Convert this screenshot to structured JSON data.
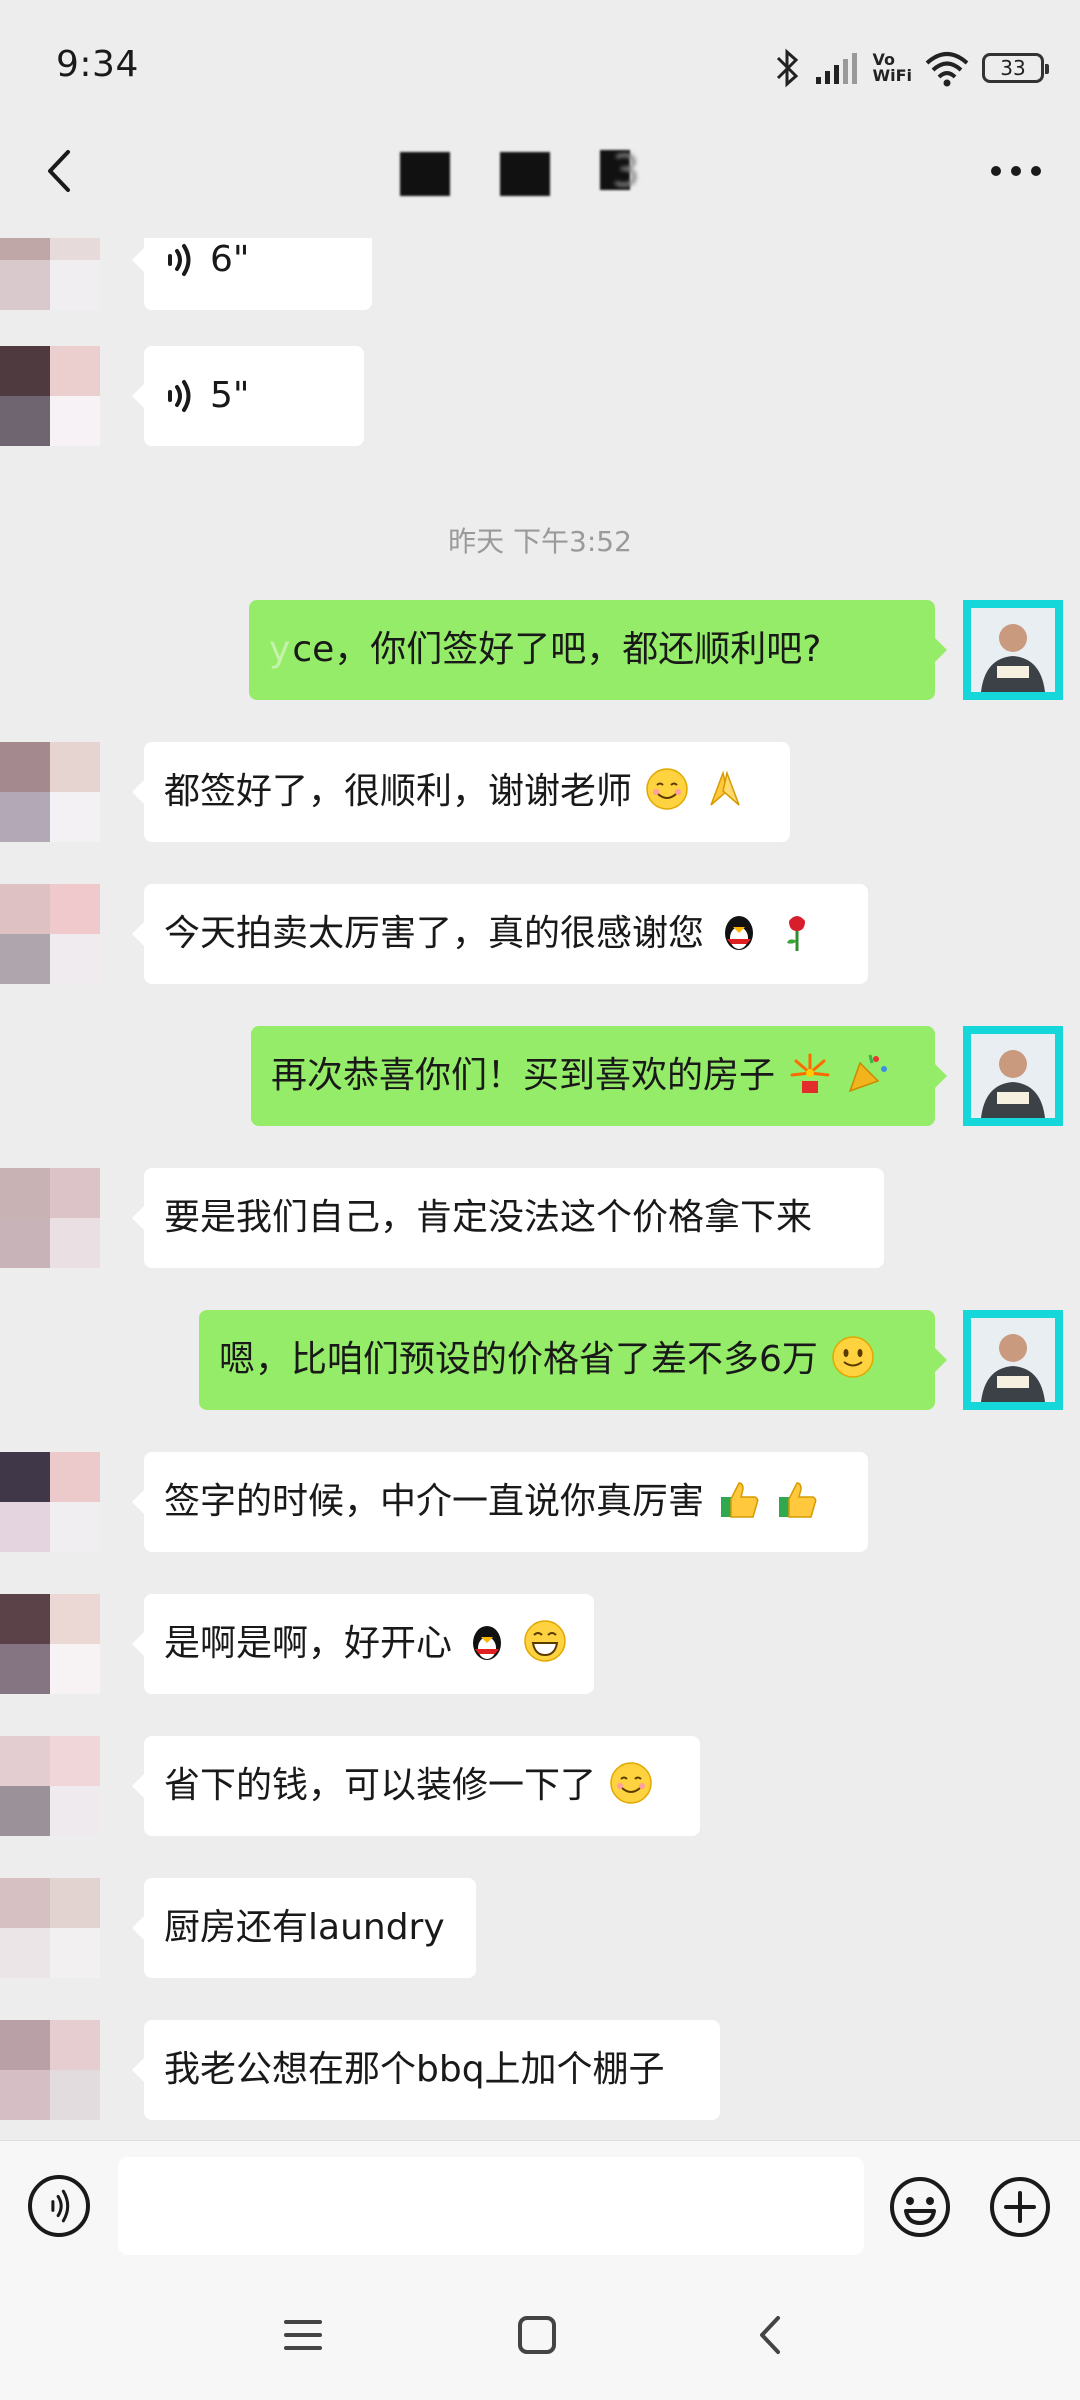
{
  "status": {
    "time": "9:34",
    "volte_line1": "Vo",
    "volte_line2": "WiFi",
    "battery": "33"
  },
  "header": {
    "title_suffix": "3"
  },
  "messages": {
    "voice1_duration": "6\"",
    "voice2_duration": "5\"",
    "timestamp": "昨天 下午3:52",
    "m1": "ce，你们签好了吧，都还顺利吧?",
    "m2": "都签好了，很顺利，谢谢老师",
    "m3": "今天拍卖太厉害了，真的很感谢您",
    "m4": "再次恭喜你们！买到喜欢的房子",
    "m5": "要是我们自己，肯定没法这个价格拿下来",
    "m6": "嗯，比咱们预设的价格省了差不多6万",
    "m7": "签字的时候，中介一直说你真厉害",
    "m8": "是啊是啊，好开心",
    "m9": "省下的钱，可以装修一下了",
    "m10": "厨房还有laundry",
    "m11": "我老公想在那个bbq上加个棚子"
  },
  "input": {
    "placeholder": ""
  },
  "colors": {
    "background": "#EDEDED",
    "outgoing_bubble": "#95EC69",
    "incoming_bubble": "#FFFFFF",
    "self_avatar_bg": "#15D6D8",
    "timestamp_text": "#9A9A9A"
  },
  "icons": {
    "status": [
      "bluetooth-icon",
      "signal-icon",
      "wifi-icon",
      "battery-icon"
    ],
    "header": [
      "back-arrow-icon",
      "more-icon"
    ],
    "input": [
      "voice-toggle-icon",
      "emoji-icon",
      "plus-icon"
    ],
    "nav": [
      "menu-icon",
      "home-icon",
      "back-icon"
    ]
  }
}
